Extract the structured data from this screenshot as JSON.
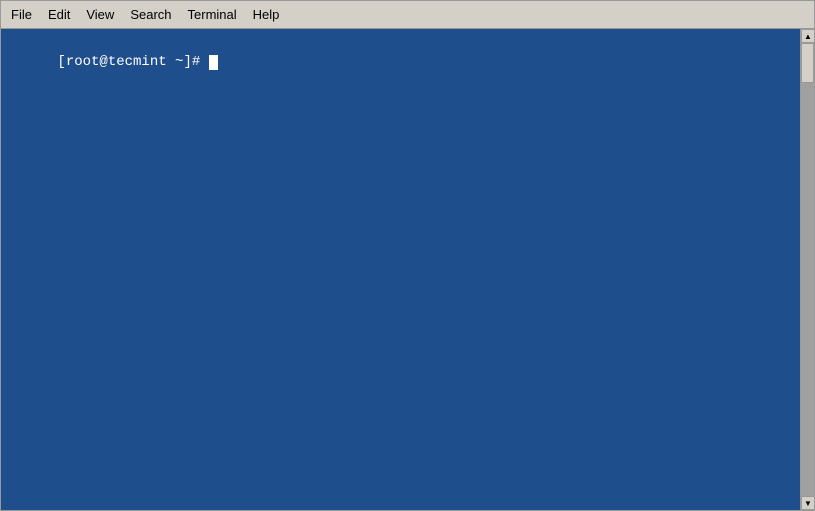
{
  "menubar": {
    "items": [
      {
        "id": "file",
        "label": "File"
      },
      {
        "id": "edit",
        "label": "Edit"
      },
      {
        "id": "view",
        "label": "View"
      },
      {
        "id": "search",
        "label": "Search"
      },
      {
        "id": "terminal",
        "label": "Terminal"
      },
      {
        "id": "help",
        "label": "Help"
      }
    ]
  },
  "terminal": {
    "prompt": "[root@tecmint ~]# ",
    "cursor_char": ""
  }
}
